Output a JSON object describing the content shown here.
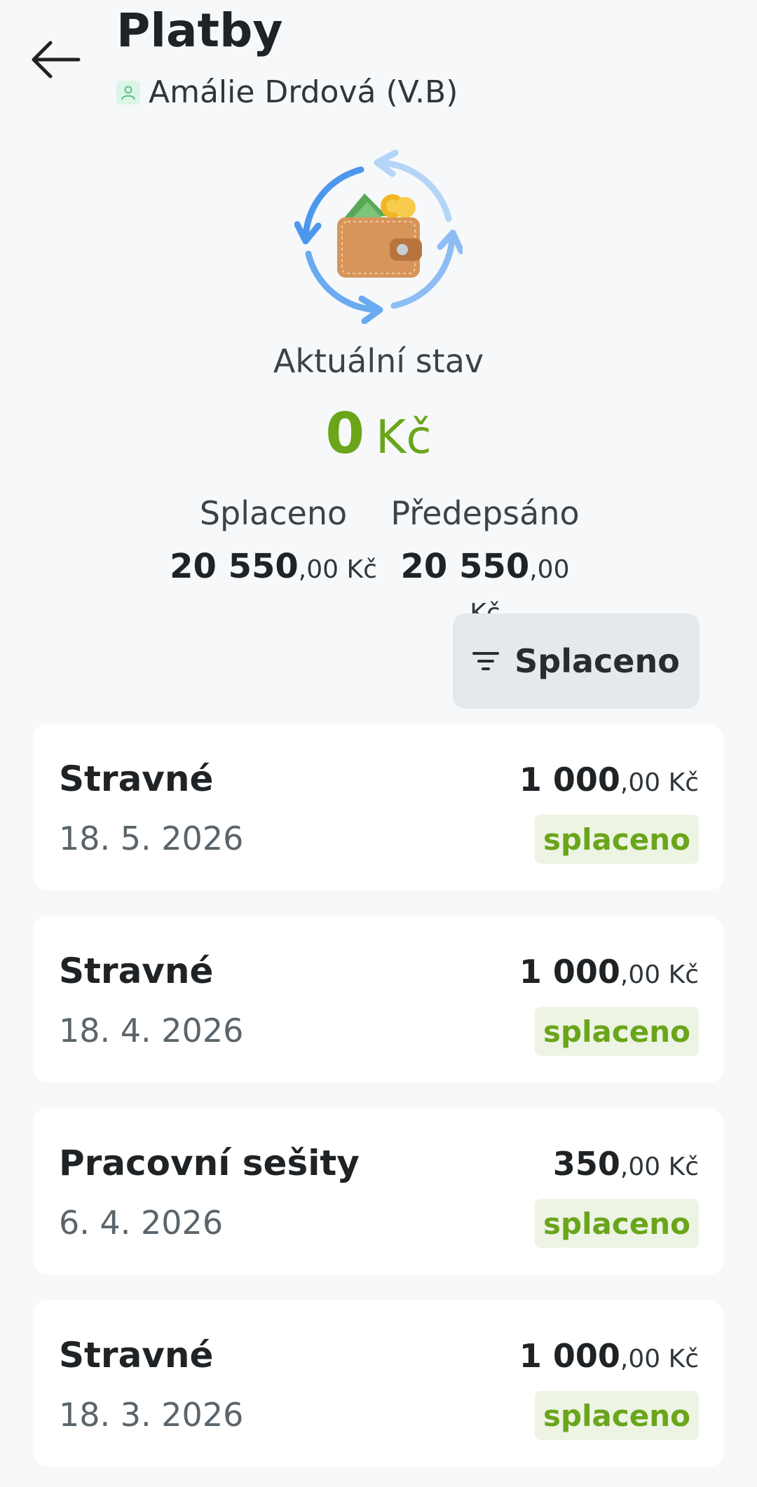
{
  "header": {
    "title": "Platby",
    "person_name": "Amálie Drdová (V.B)"
  },
  "status": {
    "label": "Aktuální stav",
    "balance_value": "0",
    "balance_currency": "Kč"
  },
  "summary": {
    "paid_label": "Splaceno",
    "paid_int": "20 550",
    "paid_dec": ",00 Kč",
    "prescribed_label": "Předepsáno",
    "prescribed_int": "20 550",
    "prescribed_dec": ",00 Kč"
  },
  "filter": {
    "label": "Splaceno"
  },
  "payments": [
    {
      "title": "Stravné",
      "date": "18. 5. 2026",
      "amount_int": "1 000",
      "amount_dec": ",00 Kč",
      "status": "splaceno"
    },
    {
      "title": "Stravné",
      "date": "18. 4. 2026",
      "amount_int": "1 000",
      "amount_dec": ",00 Kč",
      "status": "splaceno"
    },
    {
      "title": "Pracovní sešity",
      "date": "6. 4. 2026",
      "amount_int": "350",
      "amount_dec": ",00 Kč",
      "status": "splaceno"
    },
    {
      "title": "Stravné",
      "date": "18. 3. 2026",
      "amount_int": "1 000",
      "amount_dec": ",00 Kč",
      "status": "splaceno"
    }
  ],
  "icons": {
    "back": "arrow-left-icon",
    "person": "person-icon",
    "wallet": "wallet-refresh-icon",
    "filter": "filter-icon"
  },
  "colors": {
    "accent_green": "#6aa51a",
    "badge_bg": "#edf4e4",
    "background": "#f6f8fa"
  }
}
